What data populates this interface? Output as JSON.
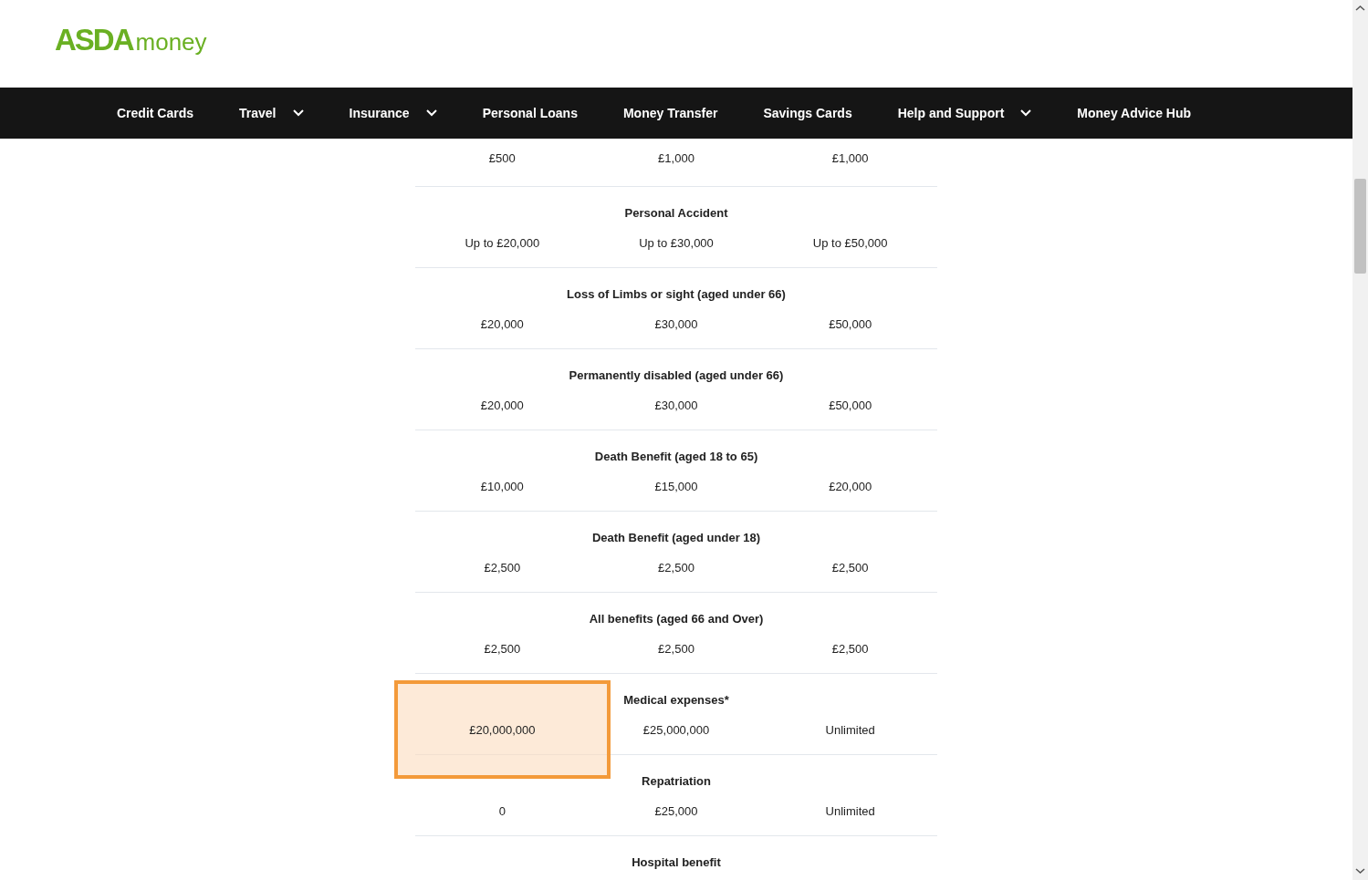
{
  "logo": {
    "brand": "ASDA",
    "product": "money"
  },
  "nav": [
    {
      "label": "Credit Cards",
      "dropdown": false
    },
    {
      "label": "Travel",
      "dropdown": true
    },
    {
      "label": "Insurance",
      "dropdown": true
    },
    {
      "label": "Personal Loans",
      "dropdown": false
    },
    {
      "label": "Money Transfer",
      "dropdown": false
    },
    {
      "label": "Savings Cards",
      "dropdown": false
    },
    {
      "label": "Help and Support",
      "dropdown": true
    },
    {
      "label": "Money Advice Hub",
      "dropdown": false
    }
  ],
  "table": {
    "rows": [
      {
        "values": [
          {
            "text": "£500",
            "highlighted": false
          },
          {
            "text": "£1,000",
            "highlighted": false
          },
          {
            "text": "£1,000",
            "highlighted": false
          }
        ]
      },
      {
        "title": "Personal Accident",
        "values": [
          {
            "text": "Up to £20,000",
            "highlighted": false
          },
          {
            "text": "Up to £30,000",
            "highlighted": false
          },
          {
            "text": "Up to £50,000",
            "highlighted": false
          }
        ]
      },
      {
        "title": "Loss of Limbs or sight (aged under 66)",
        "values": [
          {
            "text": "£20,000",
            "highlighted": false
          },
          {
            "text": "£30,000",
            "highlighted": false
          },
          {
            "text": "£50,000",
            "highlighted": false
          }
        ]
      },
      {
        "title": "Permanently disabled (aged under 66)",
        "values": [
          {
            "text": "£20,000",
            "highlighted": false
          },
          {
            "text": "£30,000",
            "highlighted": false
          },
          {
            "text": "£50,000",
            "highlighted": false
          }
        ]
      },
      {
        "title": "Death Benefit (aged 18 to 65)",
        "values": [
          {
            "text": "£10,000",
            "highlighted": false
          },
          {
            "text": "£15,000",
            "highlighted": false
          },
          {
            "text": "£20,000",
            "highlighted": false
          }
        ]
      },
      {
        "title": "Death Benefit (aged under 18)",
        "values": [
          {
            "text": "£2,500",
            "highlighted": false
          },
          {
            "text": "£2,500",
            "highlighted": false
          },
          {
            "text": "£2,500",
            "highlighted": false
          }
        ]
      },
      {
        "title": "All benefits (aged 66 and Over)",
        "values": [
          {
            "text": "£2,500",
            "highlighted": false
          },
          {
            "text": "£2,500",
            "highlighted": false
          },
          {
            "text": "£2,500",
            "highlighted": false
          }
        ]
      },
      {
        "title": "Medical expenses*",
        "values": [
          {
            "text": "£20,000,000",
            "highlighted": true
          },
          {
            "text": "£25,000,000",
            "highlighted": false
          },
          {
            "text": "Unlimited",
            "highlighted": false
          }
        ]
      },
      {
        "title": "Repatriation",
        "values": [
          {
            "text": "0",
            "highlighted": false
          },
          {
            "text": "£25,000",
            "highlighted": false
          },
          {
            "text": "Unlimited",
            "highlighted": false
          }
        ]
      },
      {
        "title": "Hospital benefit",
        "values": []
      }
    ]
  }
}
